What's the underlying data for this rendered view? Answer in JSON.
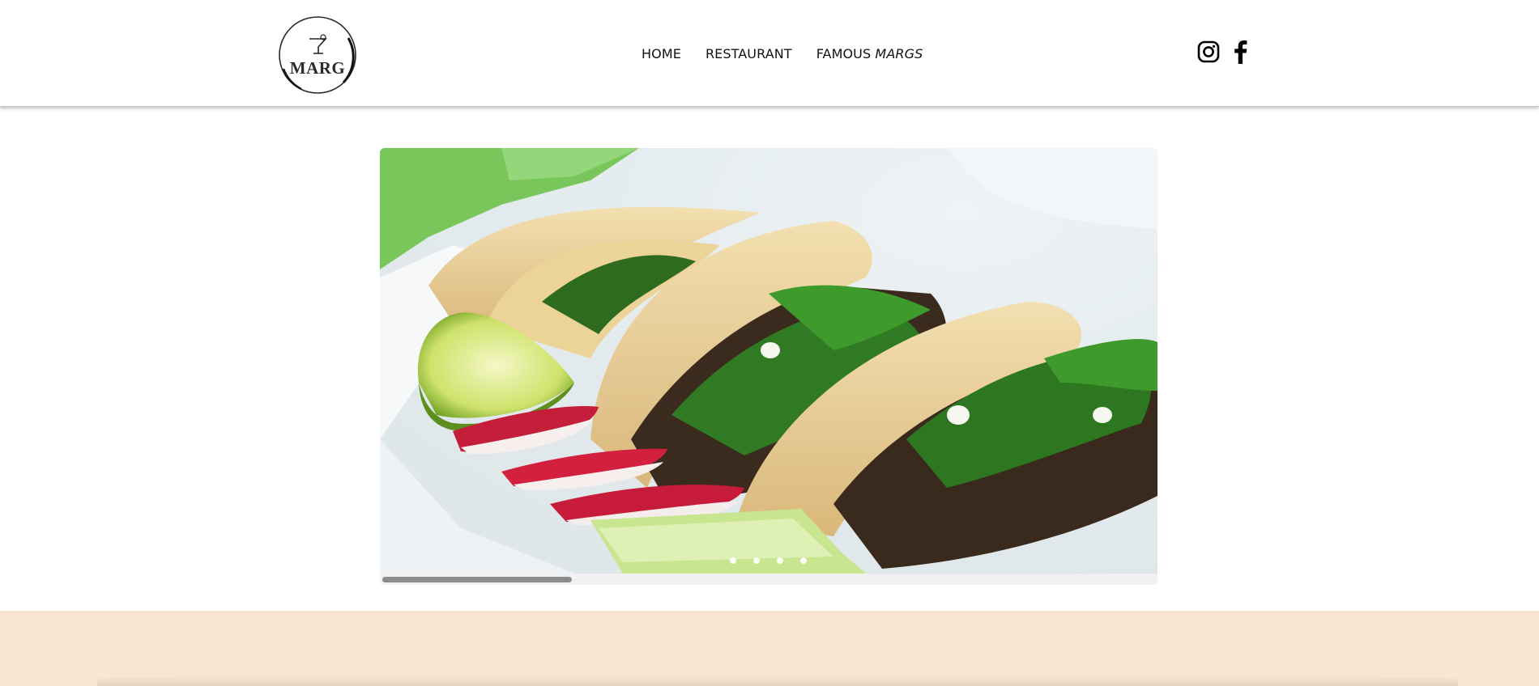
{
  "logo": {
    "text": "MARG"
  },
  "nav": {
    "items": [
      {
        "label": "HOME"
      },
      {
        "label": "RESTAURANT"
      }
    ],
    "famous": {
      "prefix": "FAMOUS ",
      "italic": "MARGS"
    }
  },
  "social": [
    {
      "name": "instagram-icon"
    },
    {
      "name": "facebook-icon"
    }
  ],
  "slider": {
    "image": "tacos with lime, radish and cilantro",
    "slide_count": 4,
    "scroll_position": 0.24
  },
  "colors": {
    "band": "#f8e6d2",
    "nav_text": "#111111",
    "scrollbar_thumb": "#8c8c8c"
  }
}
